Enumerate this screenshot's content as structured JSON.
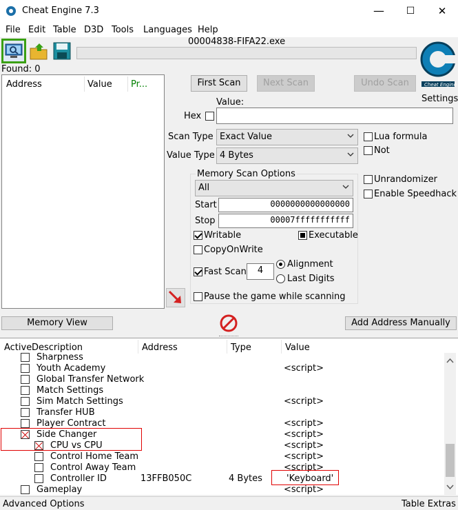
{
  "window": {
    "title": "Cheat Engine 7.3",
    "minimize": "—",
    "maximize": "☐",
    "close": "✕"
  },
  "menu": [
    "File",
    "Edit",
    "Table",
    "D3D",
    "Tools",
    "Languages",
    "Help"
  ],
  "process": {
    "name": "00004838-FIFA22.exe"
  },
  "found": "Found: 0",
  "found_list": {
    "headers": [
      "Address",
      "Value",
      "Pr..."
    ]
  },
  "logo": {
    "caption": "Cheat Engine"
  },
  "settings_label": "Settings",
  "buttons": {
    "first_scan": "First Scan",
    "next_scan": "Next Scan",
    "undo_scan": "Undo Scan",
    "memory_view": "Memory View",
    "add_address": "Add Address Manually"
  },
  "value_label": "Value:",
  "hex_label": "Hex",
  "scan_type": {
    "label": "Scan Type",
    "value": "Exact Value"
  },
  "value_type": {
    "label": "Value Type",
    "value": "4 Bytes"
  },
  "lua_formula": "Lua formula",
  "not_label": "Not",
  "unrandomizer": "Unrandomizer",
  "speedhack": "Enable Speedhack",
  "mem_options": {
    "title": "Memory Scan Options",
    "region": "All",
    "start_label": "Start",
    "start_value": "0000000000000000",
    "stop_label": "Stop",
    "stop_value": "00007fffffffffff",
    "writable": "Writable",
    "executable": "Executable",
    "copyonwrite": "CopyOnWrite",
    "fast_scan": "Fast Scan",
    "fast_scan_value": "4",
    "alignment": "Alignment",
    "last_digits": "Last Digits",
    "pause": "Pause the game while scanning"
  },
  "table": {
    "headers": {
      "active": "Active",
      "description": "Description",
      "address": "Address",
      "type": "Type",
      "value": "Value"
    },
    "rows": [
      {
        "desc": "Sharpness",
        "addr": "",
        "type": "",
        "value": ""
      },
      {
        "desc": "Youth Academy",
        "addr": "",
        "type": "",
        "value": "<script>"
      },
      {
        "desc": "Global Transfer Network",
        "addr": "",
        "type": "",
        "value": ""
      },
      {
        "desc": "Match Settings",
        "addr": "",
        "type": "",
        "value": ""
      },
      {
        "desc": "Sim Match Settings",
        "addr": "",
        "type": "",
        "value": "<script>"
      },
      {
        "desc": "Transfer HUB",
        "addr": "",
        "type": "",
        "value": ""
      },
      {
        "desc": "Player Contract",
        "addr": "",
        "type": "",
        "value": "<script>"
      },
      {
        "desc": "Side Changer",
        "addr": "",
        "type": "",
        "value": "<script>"
      },
      {
        "desc": "CPU vs CPU",
        "addr": "",
        "type": "",
        "value": "<script>"
      },
      {
        "desc": "Control Home Team",
        "addr": "",
        "type": "",
        "value": "<script>"
      },
      {
        "desc": "Control Away Team",
        "addr": "",
        "type": "",
        "value": "<script>"
      },
      {
        "desc": "Controller ID",
        "addr": "13FFB050C",
        "type": "4 Bytes",
        "value": "'Keyboard'"
      },
      {
        "desc": "Gameplay",
        "addr": "",
        "type": "",
        "value": "<script>"
      }
    ]
  },
  "status": {
    "left": "Advanced Options",
    "right": "Table Extras"
  },
  "colors": {
    "highlight_box": "#e00000",
    "process_icon_border": "#3aa012",
    "pr_header": "#008000"
  }
}
